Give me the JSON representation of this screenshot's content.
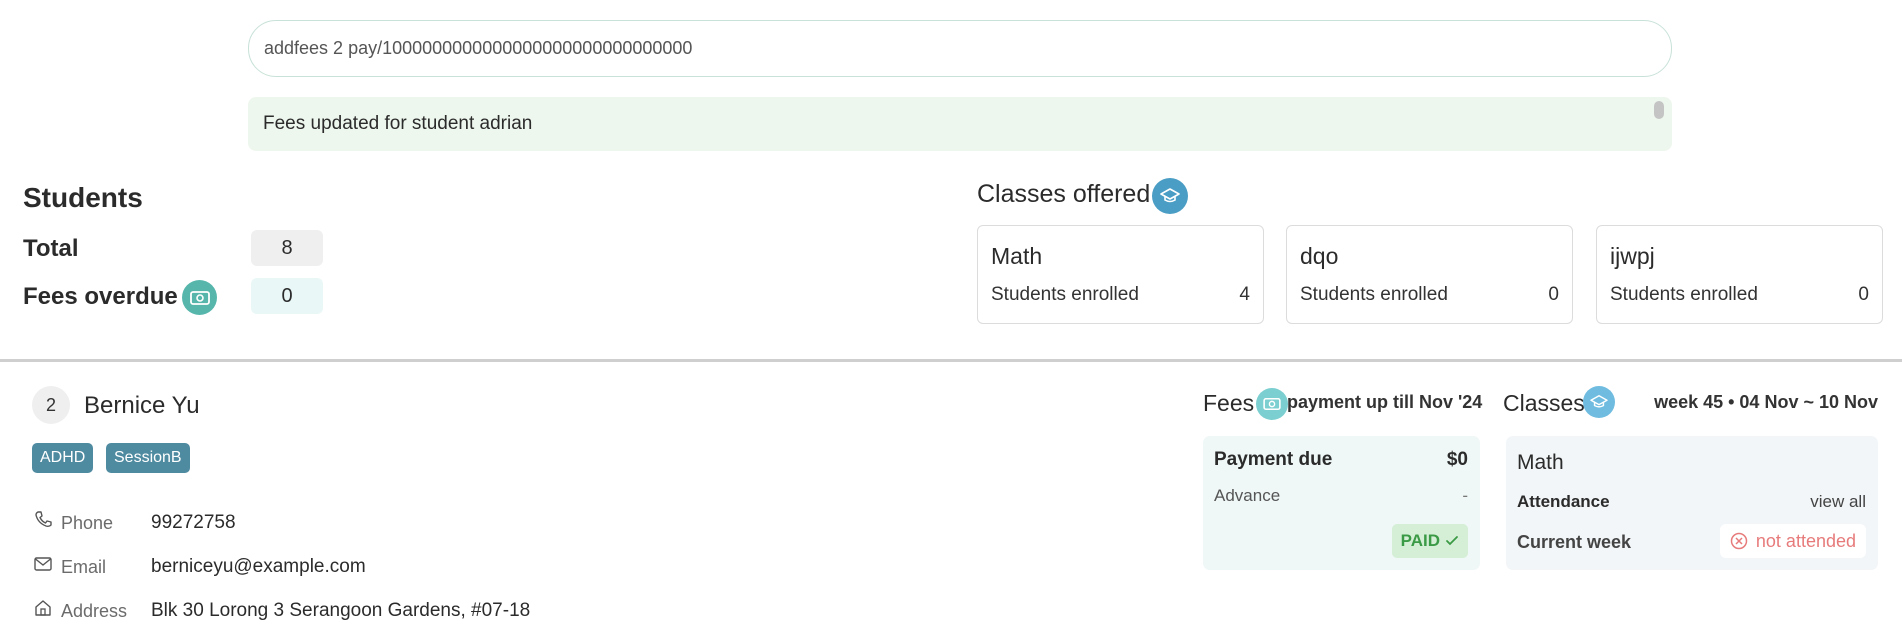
{
  "command": {
    "value": "addfees 2 pay/1000000000000000000000000000000"
  },
  "result": {
    "message": "Fees updated for student adrian"
  },
  "students": {
    "title": "Students",
    "total_label": "Total",
    "total_value": "8",
    "overdue_label": "Fees overdue",
    "overdue_value": "0",
    "overdue_icon": "money-icon"
  },
  "classes_offered": {
    "title": "Classes offered",
    "icon": "graduation-cap-icon",
    "cards": [
      {
        "name": "Math",
        "label": "Students enrolled",
        "count": "4"
      },
      {
        "name": "dqo",
        "label": "Students enrolled",
        "count": "0"
      },
      {
        "name": "ijwpj",
        "label": "Students enrolled",
        "count": "0"
      }
    ]
  },
  "student_detail": {
    "index": "2",
    "name": "Bernice Yu",
    "tags": [
      "ADHD",
      "SessionB"
    ],
    "phone_label": "Phone",
    "phone": "99272758",
    "email_label": "Email",
    "email": "berniceyu@example.com",
    "address_label": "Address",
    "address": "Blk 30 Lorong 3 Serangoon Gardens, #07-18"
  },
  "fees": {
    "title": "Fees",
    "note": "payment up till Nov '24",
    "payment_due_label": "Payment due",
    "payment_due_value": "$0",
    "advance_label": "Advance",
    "advance_value": "-",
    "status": "PAID",
    "colors": {
      "card": "#eff8f7",
      "paid_bg": "#d5efd6",
      "paid_text": "#3b9a45"
    }
  },
  "classes_panel": {
    "title": "Classes",
    "week": "week 45 • 04 Nov ~ 10 Nov",
    "class_name": "Math",
    "attendance_label": "Attendance",
    "view_all": "view all",
    "current_week_label": "Current week",
    "current_week_status": "not attended",
    "colors": {
      "status_text": "#e77b7b"
    }
  },
  "colors": {
    "tag": "#4e8aa0",
    "accent_icon": "#4a9dc4",
    "money_icon": "#4fb3a8"
  }
}
